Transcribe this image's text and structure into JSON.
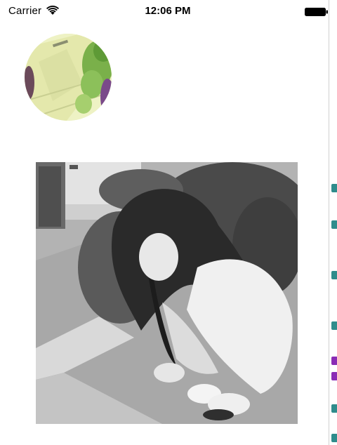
{
  "status_bar": {
    "carrier": "Carrier",
    "time": "12:06 PM",
    "wifi_icon": "wifi-icon",
    "battery_icon": "battery-icon"
  },
  "content": {
    "avatar_image": "circular-avatar-image",
    "photo_image": "grayscale-photo-image"
  },
  "colors": {
    "background": "#ffffff",
    "text": "#000000",
    "code_mark_purple": "#8a2bb5",
    "code_mark_teal": "#2f8c8c"
  }
}
